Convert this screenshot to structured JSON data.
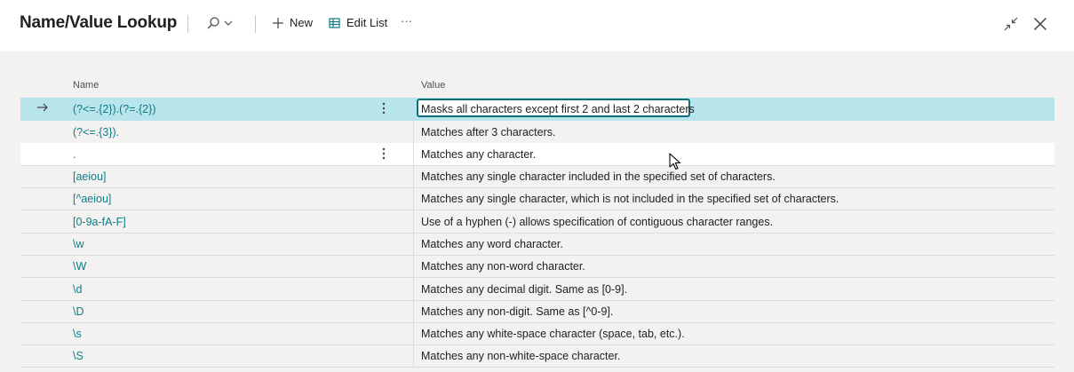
{
  "header": {
    "title": "Name/Value Lookup",
    "new_label": "New",
    "edit_list_label": "Edit List",
    "more_label": "···"
  },
  "columns": {
    "name": "Name",
    "value": "Value"
  },
  "rows": [
    {
      "name": "(?<=.{2}).(?=.{2})",
      "value": "Masks all characters except first 2 and last 2 characters",
      "state": "selected"
    },
    {
      "name": "(?<=.{3}).",
      "value": "Matches after 3 characters.",
      "state": "normal"
    },
    {
      "name": ".",
      "value": "Matches any character.",
      "state": "hover"
    },
    {
      "name": "[aeiou]",
      "value": "Matches any single character included in the specified set of characters.",
      "state": "normal"
    },
    {
      "name": "[^aeiou]",
      "value": "Matches any single character, which is not included in the specified set of characters.",
      "state": "normal"
    },
    {
      "name": "[0-9a-fA-F]",
      "value": "Use of a hyphen (-) allows specification of contiguous character ranges.",
      "state": "normal"
    },
    {
      "name": "\\w",
      "value": "Matches any word character.",
      "state": "normal"
    },
    {
      "name": "\\W",
      "value": "Matches any non-word character.",
      "state": "normal"
    },
    {
      "name": "\\d",
      "value": "Matches any decimal digit. Same as [0-9].",
      "state": "normal"
    },
    {
      "name": "\\D",
      "value": "Matches any non-digit. Same as [^0-9].",
      "state": "normal"
    },
    {
      "name": "\\s",
      "value": "Matches any white-space character (space, tab, etc.).",
      "state": "normal"
    },
    {
      "name": "\\S",
      "value": "Matches any non-white-space character.",
      "state": "normal"
    }
  ],
  "colors": {
    "accent": "#0e7c86",
    "selected_row": "#b8e4ec",
    "background": "#f3f2f1"
  }
}
